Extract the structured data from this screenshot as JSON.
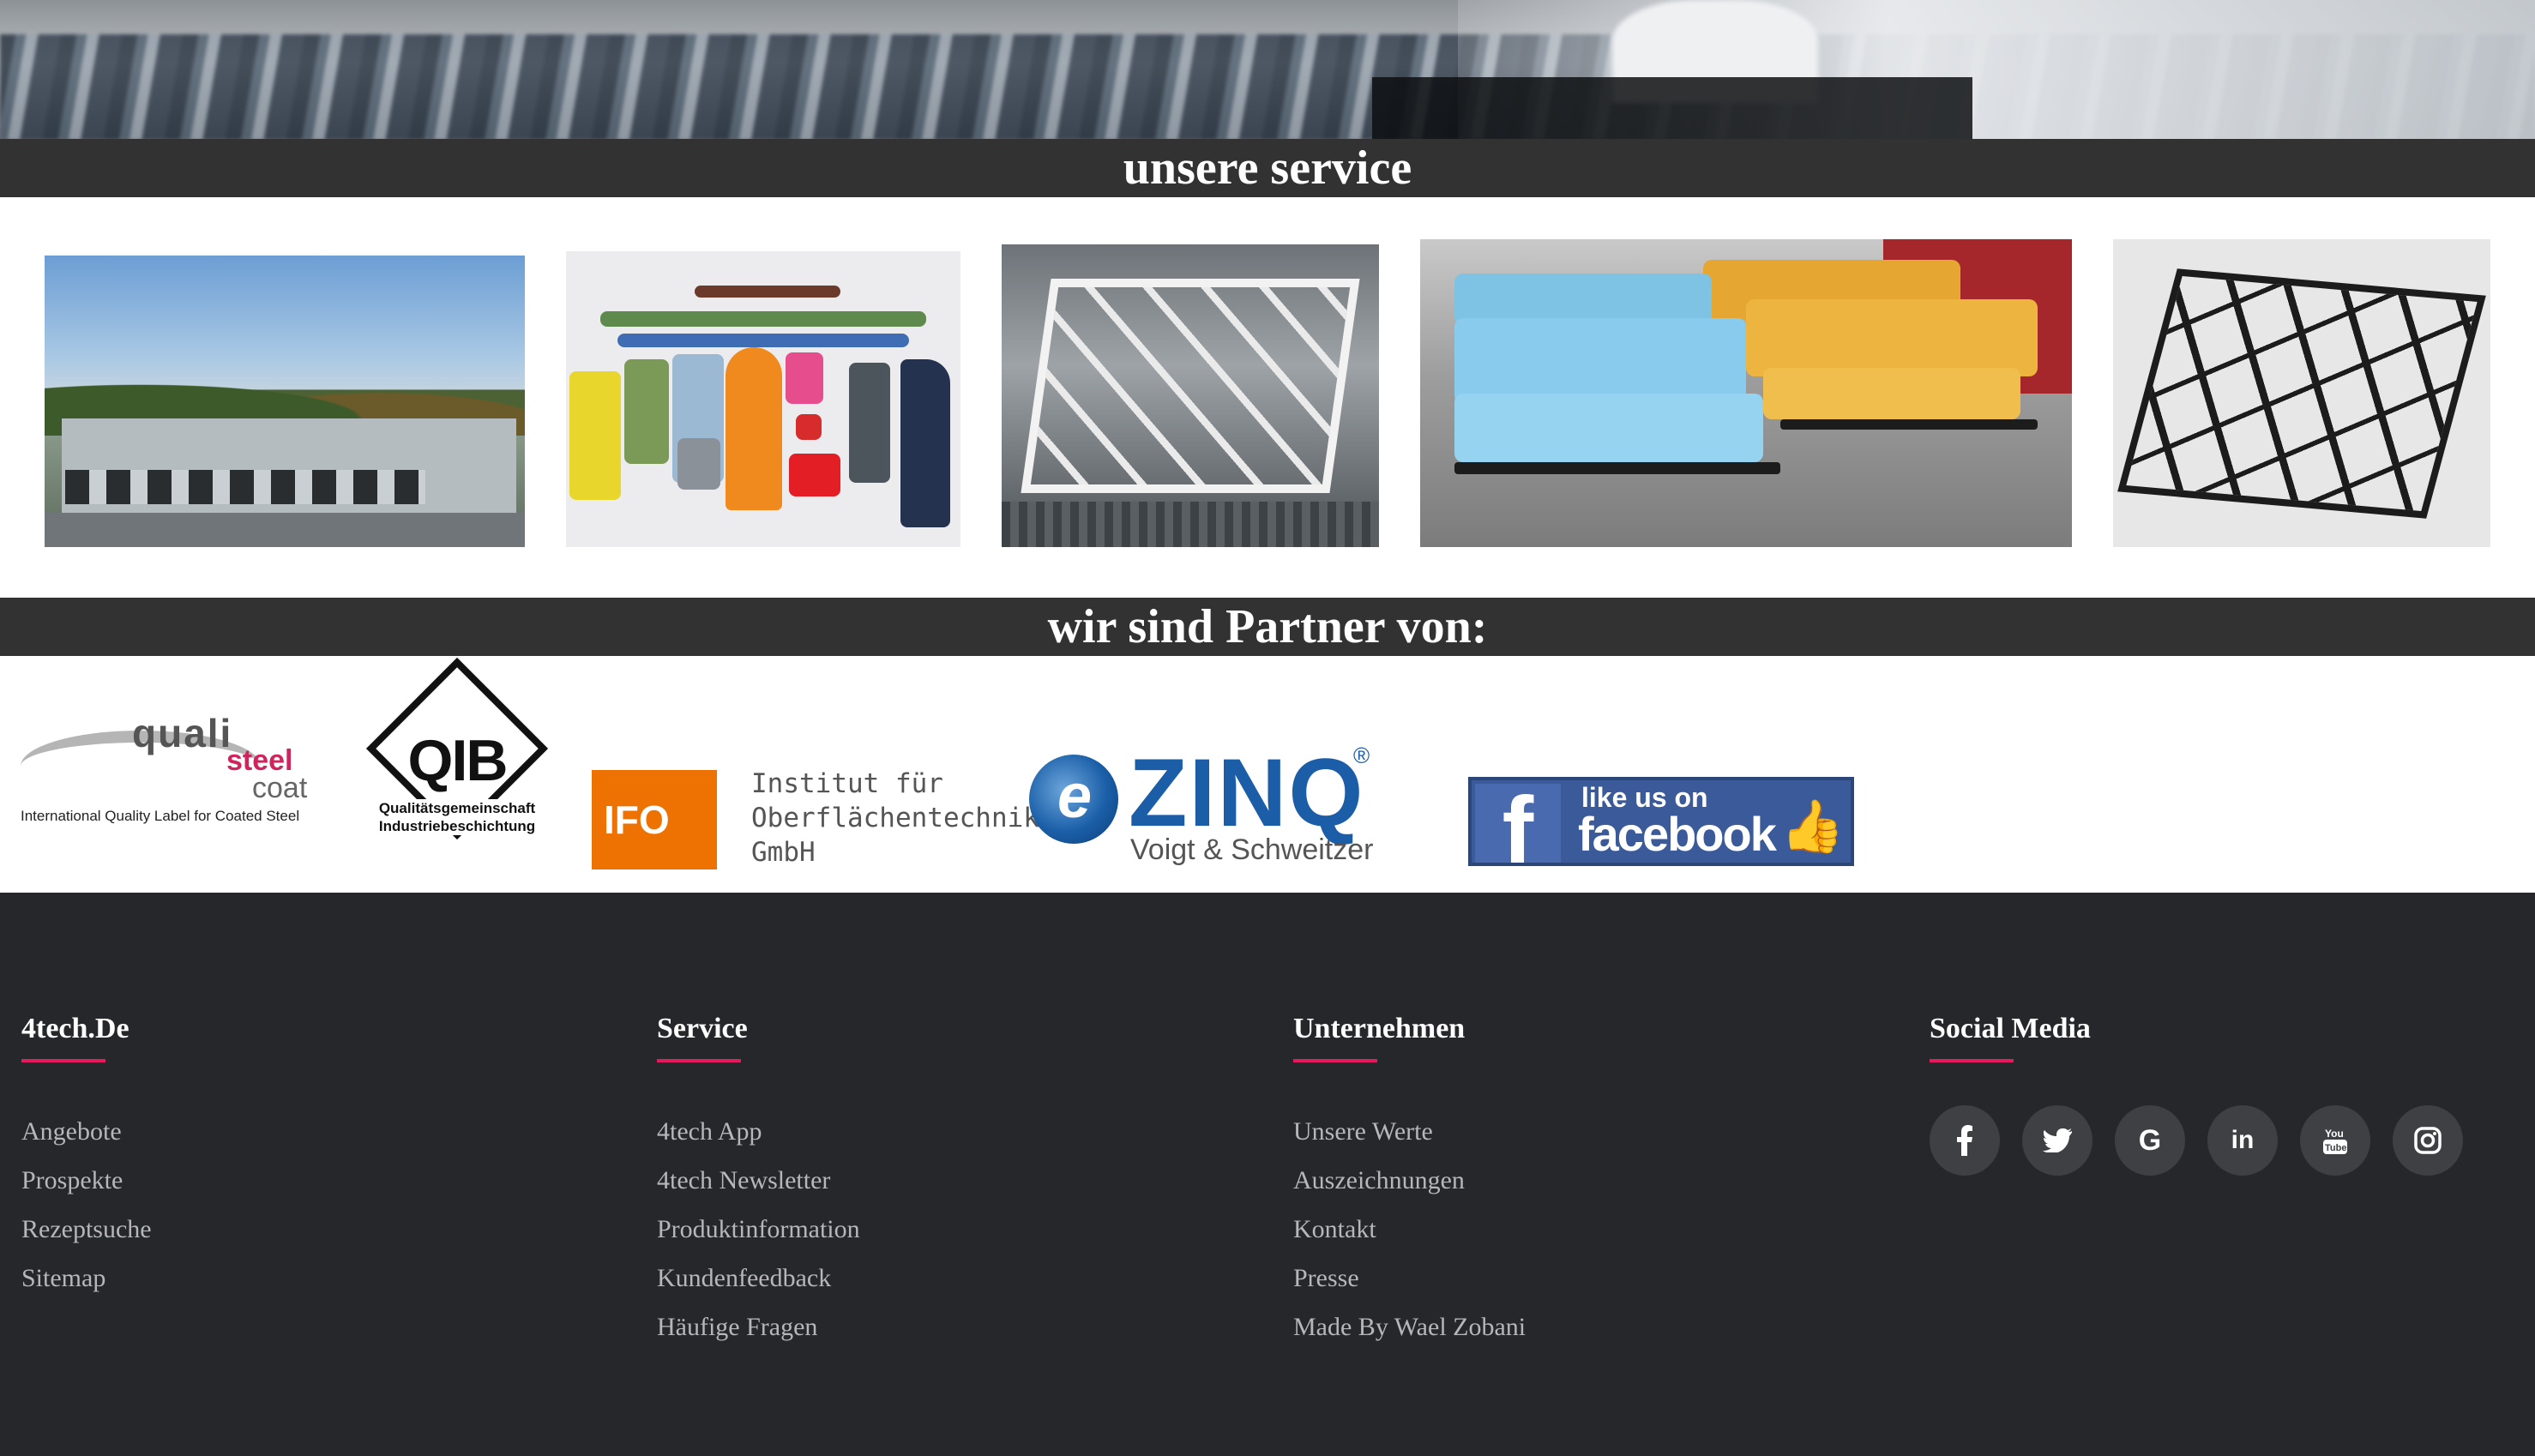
{
  "sections": {
    "service_title": "unsere service",
    "partner_title": "wir sind Partner von:"
  },
  "partners": {
    "qualisteelcoat": {
      "line1": "quali",
      "line2": "steel",
      "line3": "coat",
      "tagline": "International Quality Label for Coated Steel"
    },
    "qib": {
      "name": "QIB",
      "line1": "Qualitätsgemeinschaft",
      "line2": "Industriebeschichtung"
    },
    "ifo": {
      "mark": "IFO",
      "line1": "Institut für",
      "line2": "Oberflächentechnik",
      "line3": "GmbH"
    },
    "zinq": {
      "mark": "ZINQ",
      "registered": "®",
      "subtitle": "Voigt & Schweitzer"
    },
    "facebook": {
      "like": "like us on",
      "word": "facebook"
    }
  },
  "footer": {
    "columns": [
      {
        "title": "4tech.De",
        "links": [
          "Angebote",
          "Prospekte",
          "Rezeptsuche",
          "Sitemap"
        ]
      },
      {
        "title": "Service",
        "links": [
          "4tech App",
          "4tech Newsletter",
          "Produktinformation",
          "Kundenfeedback",
          "Häufige Fragen"
        ]
      },
      {
        "title": "Unternehmen",
        "links": [
          "Unsere Werte",
          "Auszeichnungen",
          "Kontakt",
          "Presse",
          "Made By Wael Zobani"
        ]
      },
      {
        "title": "Social Media"
      }
    ],
    "social_icons": [
      "facebook-icon",
      "twitter-icon",
      "google-icon",
      "linkedin-icon",
      "youtube-icon",
      "instagram-icon"
    ],
    "accent_color": "#e5195e",
    "background_color": "#26272b"
  }
}
